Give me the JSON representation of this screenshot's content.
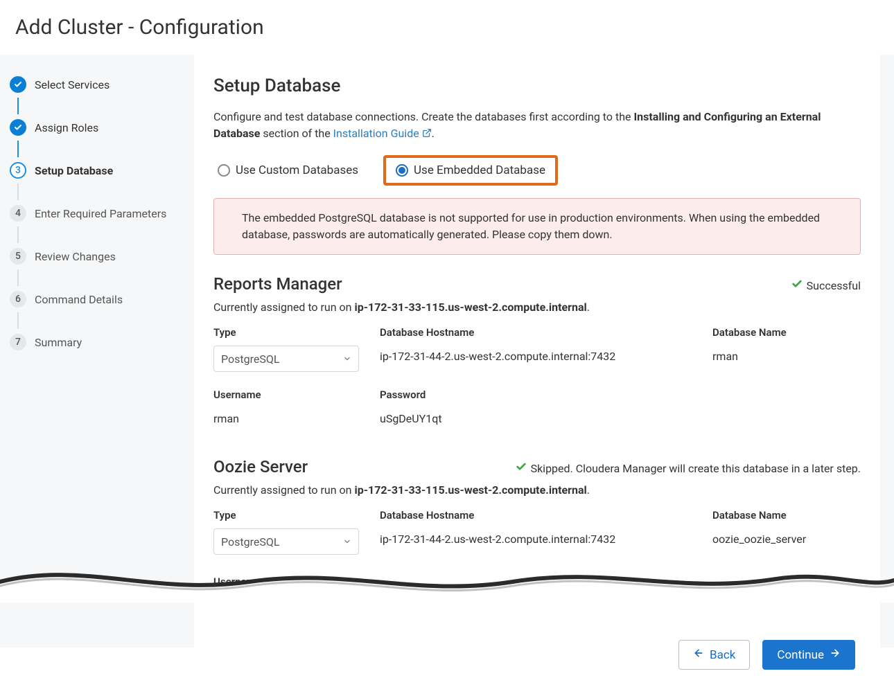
{
  "title": "Add Cluster - Configuration",
  "steps": [
    {
      "label": "Select Services",
      "state": "done",
      "index": ""
    },
    {
      "label": "Assign Roles",
      "state": "done",
      "index": ""
    },
    {
      "label": "Setup Database",
      "state": "current",
      "index": "3"
    },
    {
      "label": "Enter Required Parameters",
      "state": "upcoming",
      "index": "4"
    },
    {
      "label": "Review Changes",
      "state": "upcoming",
      "index": "5"
    },
    {
      "label": "Command Details",
      "state": "upcoming",
      "index": "6"
    },
    {
      "label": "Summary",
      "state": "upcoming",
      "index": "7"
    }
  ],
  "panel": {
    "heading": "Setup Database",
    "intro_prefix": "Configure and test database connections. Create the databases first according to the ",
    "intro_bold": "Installing and Configuring an External Database",
    "intro_middle": " section of the ",
    "intro_link": "Installation Guide",
    "intro_suffix": ".",
    "radio_custom": "Use Custom Databases",
    "radio_embedded": "Use Embedded Database",
    "alert": "The embedded PostgreSQL database is not supported for use in production environments. When using the embedded database, passwords are automatically generated. Please copy them down."
  },
  "labels": {
    "type": "Type",
    "hostname": "Database Hostname",
    "dbname": "Database Name",
    "username": "Username",
    "password": "Password",
    "assigned_prefix": "Currently assigned to run on "
  },
  "reports": {
    "title": "Reports Manager",
    "status": "Successful",
    "host": "ip-172-31-33-115.us-west-2.compute.internal",
    "type": "PostgreSQL",
    "db_host": "ip-172-31-44-2.us-west-2.compute.internal:7432",
    "db_name": "rman",
    "username": "rman",
    "password": "uSgDeUY1qt"
  },
  "oozie": {
    "title": "Oozie Server",
    "status": "Skipped. Cloudera Manager will create this database in a later step.",
    "host": "ip-172-31-33-115.us-west-2.compute.internal",
    "type": "PostgreSQL",
    "db_host": "ip-172-31-44-2.us-west-2.compute.internal:7432",
    "db_name": "oozie_oozie_server"
  },
  "trunc_username_label": "Username",
  "footer": {
    "back": "Back",
    "continue": "Continue"
  }
}
